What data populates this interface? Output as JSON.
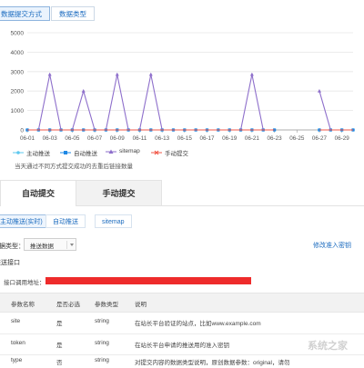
{
  "top_tabs": [
    {
      "label": "数据提交方式",
      "active": true
    },
    {
      "label": "数据类型",
      "active": false
    }
  ],
  "chart_data": {
    "type": "line",
    "x": [
      "06-01",
      "06-02",
      "06-03",
      "06-04",
      "06-05",
      "06-06",
      "06-07",
      "06-08",
      "06-09",
      "06-10",
      "06-11",
      "06-12",
      "06-13",
      "06-14",
      "06-15",
      "06-16",
      "06-17",
      "06-18",
      "06-19",
      "06-20",
      "06-21",
      "06-22",
      "06-23",
      "06-24",
      "06-25",
      "06-26",
      "06-27",
      "06-28",
      "06-29",
      "06-30"
    ],
    "x_tick_labels": [
      "06-01",
      "06-03",
      "06-05",
      "06-07",
      "06-09",
      "06-11",
      "06-13",
      "06-15",
      "06-17",
      "06-19",
      "06-21",
      "06-23",
      "06-25",
      "06-27",
      "06-29"
    ],
    "ylim": [
      0,
      5000
    ],
    "y_ticks": [
      "0",
      "1000",
      "2000",
      "3000",
      "4000",
      "5000"
    ],
    "grid": true,
    "legend_position": "bottom",
    "series": [
      {
        "name": "主动推送",
        "color": "#5ec8ef",
        "marker": "circle",
        "values": [
          0,
          0,
          0,
          0,
          0,
          0,
          0,
          0,
          0,
          0,
          0,
          0,
          0,
          0,
          0,
          0,
          0,
          0,
          0,
          0,
          0,
          0,
          0,
          null,
          null,
          null,
          0,
          0,
          0,
          0
        ]
      },
      {
        "name": "自动推送",
        "color": "#1e88e5",
        "marker": "square",
        "values": [
          0,
          0,
          0,
          0,
          0,
          0,
          0,
          0,
          0,
          0,
          0,
          0,
          0,
          0,
          0,
          0,
          0,
          0,
          0,
          0,
          0,
          0,
          0,
          null,
          null,
          null,
          0,
          0,
          0,
          0
        ]
      },
      {
        "name": "sitemap",
        "color": "#8e6fcb",
        "marker": "triangle",
        "values": [
          0,
          0,
          2850,
          0,
          0,
          2000,
          0,
          0,
          2850,
          0,
          0,
          2850,
          0,
          0,
          0,
          0,
          0,
          0,
          0,
          0,
          2850,
          0,
          0,
          null,
          null,
          null,
          2000,
          0,
          0,
          0
        ]
      },
      {
        "name": "手动提交",
        "color": "#f25a4a",
        "marker": "cross",
        "values": [
          0,
          0,
          0,
          0,
          0,
          0,
          0,
          0,
          0,
          0,
          0,
          0,
          0,
          0,
          0,
          0,
          0,
          0,
          0,
          0,
          0,
          0,
          0,
          null,
          null,
          null,
          0,
          0,
          0,
          0
        ]
      }
    ]
  },
  "chart_note": "当天通过不同方式提交成功的去重后链接数量",
  "main_tabs": [
    {
      "label": "自动提交",
      "active": true
    },
    {
      "label": "手动提交",
      "active": false
    }
  ],
  "sub_tabs": [
    {
      "label": "主动推送(实时)",
      "active": true
    },
    {
      "label": "自动推送",
      "active": false
    },
    {
      "label": "sitemap",
      "active": false
    }
  ],
  "data_type": {
    "label": "数据类型：",
    "selected": "推送数据",
    "dropdown_icon": "caret-down-icon",
    "modify_link": "修改准入密钥"
  },
  "section_title": "推送接口",
  "api_address_label": "接口调用地址：",
  "table": {
    "headers": [
      "参数名称",
      "是否必选",
      "参数类型",
      "说明"
    ],
    "rows": [
      [
        "site",
        "是",
        "string",
        "在站长平台验证的站点，比如www.example.com"
      ],
      [
        "token",
        "是",
        "string",
        "在站长平台申请的推送用的准入密钥"
      ],
      [
        "type",
        "否",
        "string",
        "对提交内容的数据类型说明，原创数据参数：original，请勿"
      ]
    ]
  },
  "watermark": "系统之家"
}
